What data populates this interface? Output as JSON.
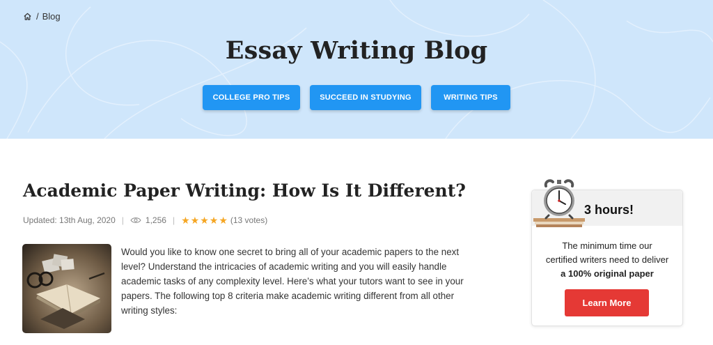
{
  "breadcrumb": {
    "home_icon": "home-icon",
    "separator": "/",
    "current": "Blog"
  },
  "hero": {
    "title": "Essay Writing Blog",
    "categories": [
      "COLLEGE PRO TIPS",
      "SUCCEED IN STUDYING",
      "WRITING TIPS"
    ]
  },
  "article": {
    "title": "Academic Paper Writing: How Is It Different?",
    "updated": "Updated: 13th Aug, 2020",
    "views": "1,256",
    "views_icon": "eye-icon",
    "rating": 5,
    "votes": "(13 votes)",
    "intro": "Would you like to know one secret to bring all of your academic papers to the next level? Understand the intricacies of academic writing and you will easily handle academic tasks of any complexity level. Here’s what your tutors want to see in your papers. The following top 8 criteria make academic writing different from all other writing styles:"
  },
  "promo": {
    "headline": "3 hours!",
    "line1": "The minimum time our",
    "line2": "certified writers need to deliver",
    "line3": "a 100% original paper",
    "button": "Learn More"
  },
  "colors": {
    "hero_bg": "#cfe6fb",
    "accent_blue": "#2196f3",
    "cta_red": "#e53935",
    "star": "#f5a623"
  }
}
